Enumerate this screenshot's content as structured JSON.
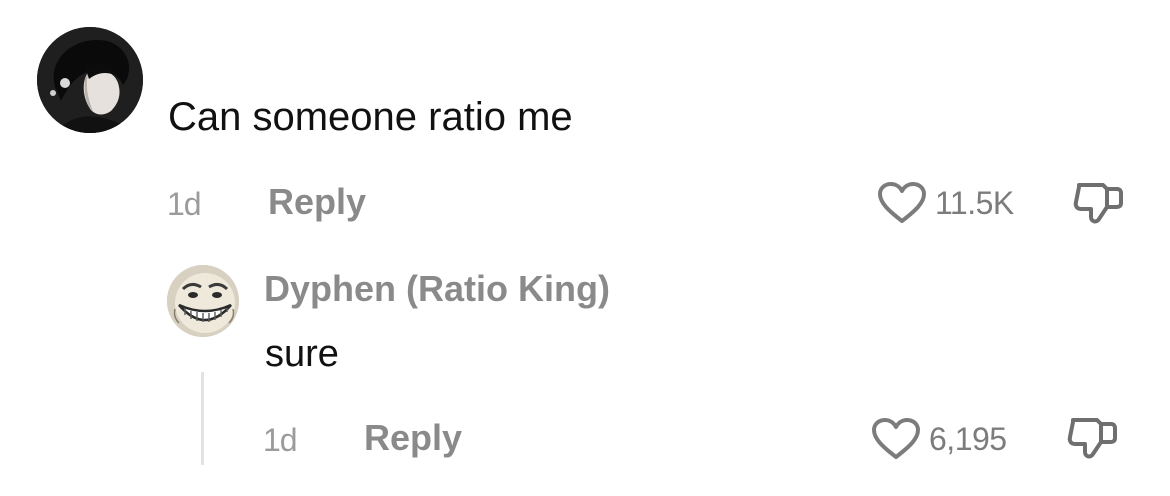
{
  "comment": {
    "text": "Can someone ratio me",
    "time": "1d",
    "reply_label": "Reply",
    "likes": "11.5K",
    "avatar_icon": "user-photo-avatar"
  },
  "reply": {
    "author": "Dyphen (Ratio King)",
    "text": "sure",
    "time": "1d",
    "reply_label": "Reply",
    "likes": "6,195",
    "avatar_icon": "trollface-avatar"
  },
  "icons": {
    "like": "heart-outline-icon",
    "dislike": "thumbs-down-icon"
  },
  "colors": {
    "text": "#111111",
    "muted": "#8a8a8a",
    "thread_line": "#e3e3e3"
  }
}
